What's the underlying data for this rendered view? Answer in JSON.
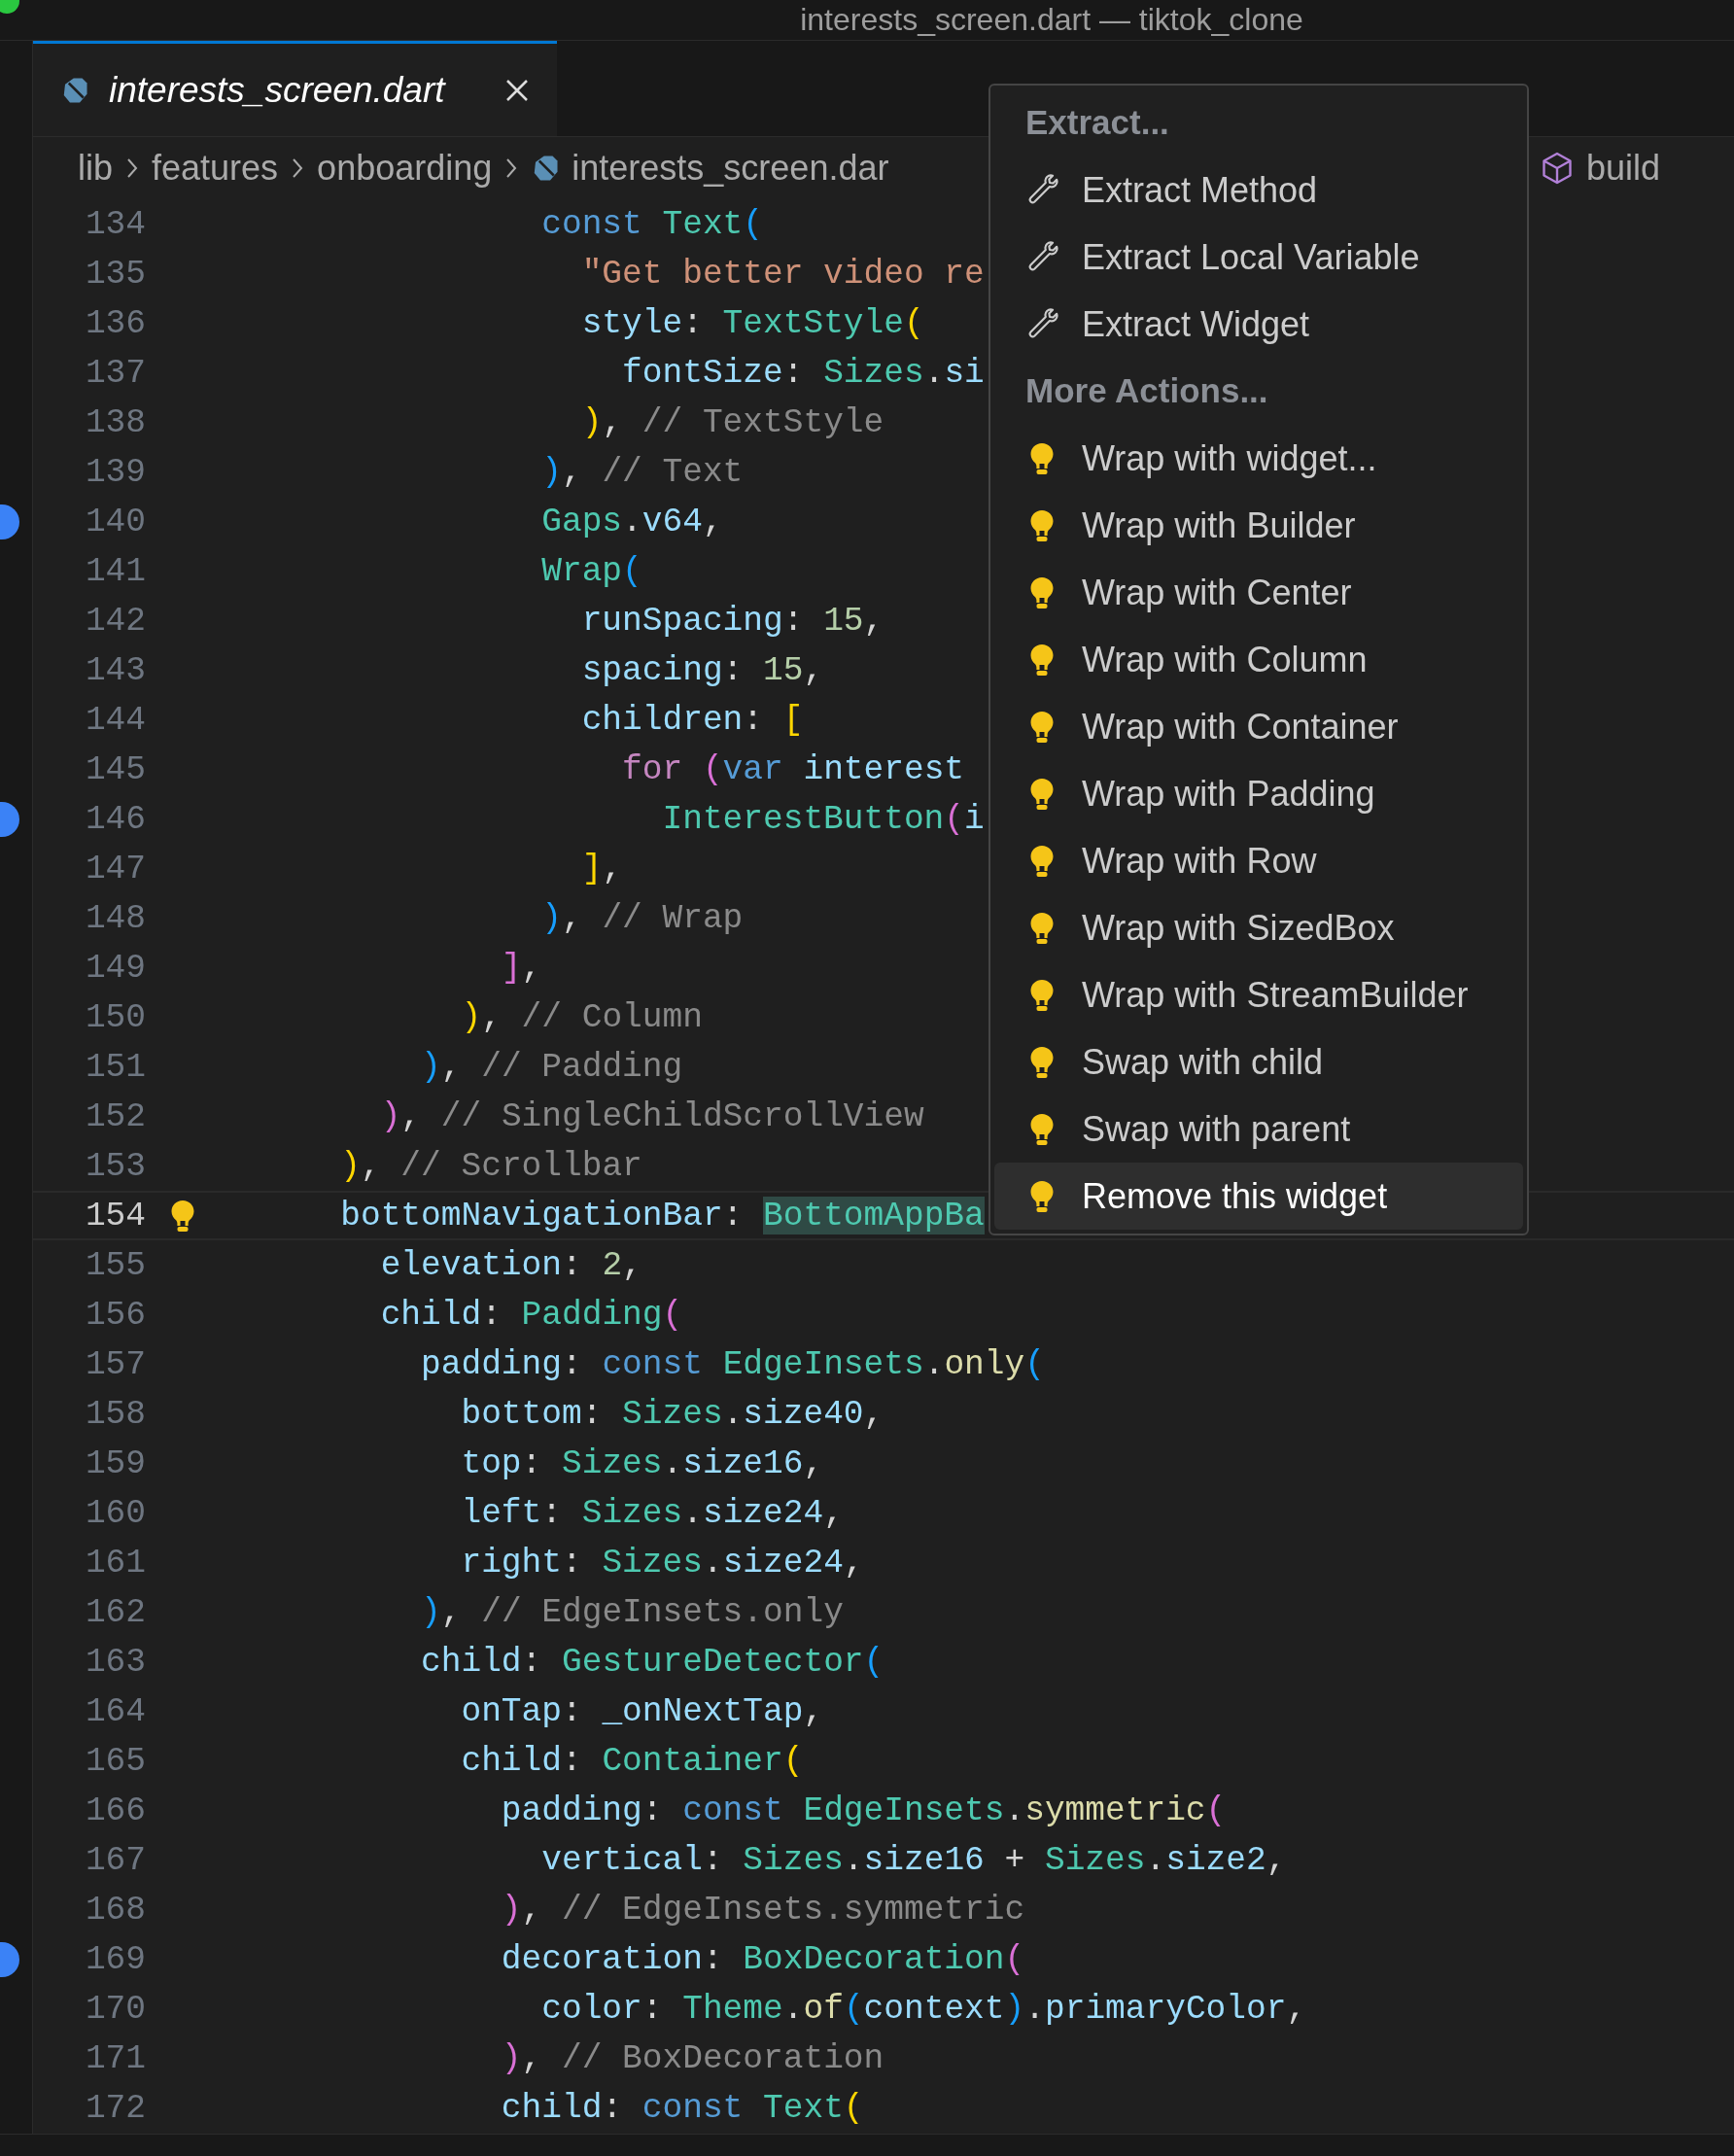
{
  "window": {
    "title": "interests_screen.dart — tiktok_clone"
  },
  "tabs": [
    {
      "label": "interests_screen.dart",
      "selected": true
    }
  ],
  "breadcrumb": [
    {
      "label": "lib",
      "kind": "folder"
    },
    {
      "label": "features",
      "kind": "folder"
    },
    {
      "label": "onboarding",
      "kind": "folder"
    },
    {
      "label": "interests_screen.dar",
      "kind": "file"
    },
    {
      "label": "build",
      "kind": "symbol"
    }
  ],
  "editor": {
    "lines": [
      {
        "number": "134",
        "active": false,
        "marked": false,
        "tokens": [
          {
            "kind": "keyword",
            "text": "                const "
          },
          {
            "kind": "type",
            "text": "Text"
          },
          {
            "kind": "bracket-blue",
            "text": "("
          }
        ]
      },
      {
        "number": "135",
        "active": false,
        "marked": false,
        "tokens": [
          {
            "kind": "string",
            "text": "                  \"Get better video re"
          }
        ]
      },
      {
        "number": "136",
        "active": false,
        "marked": false,
        "tokens": [
          {
            "kind": "prop",
            "text": "                  style"
          },
          {
            "kind": "plain",
            "text": ": "
          },
          {
            "kind": "type",
            "text": "TextStyle"
          },
          {
            "kind": "bracket-yellow",
            "text": "("
          }
        ]
      },
      {
        "number": "137",
        "active": false,
        "marked": false,
        "tokens": [
          {
            "kind": "prop",
            "text": "                    fontSize"
          },
          {
            "kind": "plain",
            "text": ": "
          },
          {
            "kind": "type",
            "text": "Sizes"
          },
          {
            "kind": "plain",
            "text": "."
          },
          {
            "kind": "prop",
            "text": "si"
          }
        ]
      },
      {
        "number": "138",
        "active": false,
        "marked": false,
        "tokens": [
          {
            "kind": "bracket-yellow",
            "text": "                  )"
          },
          {
            "kind": "plain",
            "text": ", "
          },
          {
            "kind": "comment",
            "text": "// TextStyle"
          }
        ]
      },
      {
        "number": "139",
        "active": false,
        "marked": false,
        "tokens": [
          {
            "kind": "bracket-blue",
            "text": "                )"
          },
          {
            "kind": "plain",
            "text": ", "
          },
          {
            "kind": "comment",
            "text": "// Text"
          }
        ]
      },
      {
        "number": "140",
        "active": false,
        "marked": true,
        "tokens": [
          {
            "kind": "type",
            "text": "                Gaps"
          },
          {
            "kind": "plain",
            "text": "."
          },
          {
            "kind": "prop",
            "text": "v64"
          },
          {
            "kind": "plain",
            "text": ","
          }
        ]
      },
      {
        "number": "141",
        "active": false,
        "marked": false,
        "tokens": [
          {
            "kind": "type",
            "text": "                Wrap"
          },
          {
            "kind": "bracket-blue",
            "text": "("
          }
        ]
      },
      {
        "number": "142",
        "active": false,
        "marked": false,
        "tokens": [
          {
            "kind": "prop",
            "text": "                  runSpacing"
          },
          {
            "kind": "plain",
            "text": ": "
          },
          {
            "kind": "number",
            "text": "15"
          },
          {
            "kind": "plain",
            "text": ","
          }
        ]
      },
      {
        "number": "143",
        "active": false,
        "marked": false,
        "tokens": [
          {
            "kind": "prop",
            "text": "                  spacing"
          },
          {
            "kind": "plain",
            "text": ": "
          },
          {
            "kind": "number",
            "text": "15"
          },
          {
            "kind": "plain",
            "text": ","
          }
        ]
      },
      {
        "number": "144",
        "active": false,
        "marked": false,
        "tokens": [
          {
            "kind": "prop",
            "text": "                  children"
          },
          {
            "kind": "plain",
            "text": ": "
          },
          {
            "kind": "bracket-yellow",
            "text": "["
          }
        ]
      },
      {
        "number": "145",
        "active": false,
        "marked": false,
        "tokens": [
          {
            "kind": "control",
            "text": "                    for "
          },
          {
            "kind": "bracket-purple",
            "text": "("
          },
          {
            "kind": "keyword",
            "text": "var "
          },
          {
            "kind": "prop",
            "text": "interest"
          }
        ]
      },
      {
        "number": "146",
        "active": false,
        "marked": true,
        "tokens": [
          {
            "kind": "type",
            "text": "                      InterestButton"
          },
          {
            "kind": "bracket-purple",
            "text": "("
          },
          {
            "kind": "prop",
            "text": "i"
          }
        ]
      },
      {
        "number": "147",
        "active": false,
        "marked": false,
        "tokens": [
          {
            "kind": "bracket-yellow",
            "text": "                  ]"
          },
          {
            "kind": "plain",
            "text": ","
          }
        ]
      },
      {
        "number": "148",
        "active": false,
        "marked": false,
        "tokens": [
          {
            "kind": "bracket-blue",
            "text": "                )"
          },
          {
            "kind": "plain",
            "text": ", "
          },
          {
            "kind": "comment",
            "text": "// Wrap"
          }
        ]
      },
      {
        "number": "149",
        "active": false,
        "marked": false,
        "tokens": [
          {
            "kind": "bracket-purple",
            "text": "              ]"
          },
          {
            "kind": "plain",
            "text": ","
          }
        ]
      },
      {
        "number": "150",
        "active": false,
        "marked": false,
        "tokens": [
          {
            "kind": "bracket-yellow",
            "text": "            )"
          },
          {
            "kind": "plain",
            "text": ", "
          },
          {
            "kind": "comment",
            "text": "// Column"
          }
        ]
      },
      {
        "number": "151",
        "active": false,
        "marked": false,
        "tokens": [
          {
            "kind": "bracket-blue",
            "text": "          )"
          },
          {
            "kind": "plain",
            "text": ", "
          },
          {
            "kind": "comment",
            "text": "// Padding"
          }
        ]
      },
      {
        "number": "152",
        "active": false,
        "marked": false,
        "tokens": [
          {
            "kind": "bracket-purple",
            "text": "        )"
          },
          {
            "kind": "plain",
            "text": ", "
          },
          {
            "kind": "comment",
            "text": "// SingleChildScrollView"
          }
        ]
      },
      {
        "number": "153",
        "active": false,
        "marked": false,
        "tokens": [
          {
            "kind": "bracket-yellow",
            "text": "      )"
          },
          {
            "kind": "plain",
            "text": ", "
          },
          {
            "kind": "comment",
            "text": "// Scrollbar"
          }
        ]
      },
      {
        "number": "154",
        "active": true,
        "marked": false,
        "tokens": [
          {
            "kind": "prop",
            "text": "      bottomNavigationBar"
          },
          {
            "kind": "plain",
            "text": ": "
          },
          {
            "kind": "selection",
            "text": "BottomAppBa"
          }
        ]
      },
      {
        "number": "155",
        "active": false,
        "marked": false,
        "tokens": [
          {
            "kind": "prop",
            "text": "        elevation"
          },
          {
            "kind": "plain",
            "text": ": "
          },
          {
            "kind": "number",
            "text": "2"
          },
          {
            "kind": "plain",
            "text": ","
          }
        ]
      },
      {
        "number": "156",
        "active": false,
        "marked": false,
        "tokens": [
          {
            "kind": "prop",
            "text": "        child"
          },
          {
            "kind": "plain",
            "text": ": "
          },
          {
            "kind": "type",
            "text": "Padding"
          },
          {
            "kind": "bracket-purple",
            "text": "("
          }
        ]
      },
      {
        "number": "157",
        "active": false,
        "marked": false,
        "tokens": [
          {
            "kind": "prop",
            "text": "          padding"
          },
          {
            "kind": "plain",
            "text": ": "
          },
          {
            "kind": "keyword",
            "text": "const "
          },
          {
            "kind": "type",
            "text": "EdgeInsets"
          },
          {
            "kind": "plain",
            "text": "."
          },
          {
            "kind": "method",
            "text": "only"
          },
          {
            "kind": "bracket-blue",
            "text": "("
          }
        ]
      },
      {
        "number": "158",
        "active": false,
        "marked": false,
        "tokens": [
          {
            "kind": "prop",
            "text": "            bottom"
          },
          {
            "kind": "plain",
            "text": ": "
          },
          {
            "kind": "type",
            "text": "Sizes"
          },
          {
            "kind": "plain",
            "text": "."
          },
          {
            "kind": "prop",
            "text": "size40"
          },
          {
            "kind": "plain",
            "text": ","
          }
        ]
      },
      {
        "number": "159",
        "active": false,
        "marked": false,
        "tokens": [
          {
            "kind": "prop",
            "text": "            top"
          },
          {
            "kind": "plain",
            "text": ": "
          },
          {
            "kind": "type",
            "text": "Sizes"
          },
          {
            "kind": "plain",
            "text": "."
          },
          {
            "kind": "prop",
            "text": "size16"
          },
          {
            "kind": "plain",
            "text": ","
          }
        ]
      },
      {
        "number": "160",
        "active": false,
        "marked": false,
        "tokens": [
          {
            "kind": "prop",
            "text": "            left"
          },
          {
            "kind": "plain",
            "text": ": "
          },
          {
            "kind": "type",
            "text": "Sizes"
          },
          {
            "kind": "plain",
            "text": "."
          },
          {
            "kind": "prop",
            "text": "size24"
          },
          {
            "kind": "plain",
            "text": ","
          }
        ]
      },
      {
        "number": "161",
        "active": false,
        "marked": false,
        "tokens": [
          {
            "kind": "prop",
            "text": "            right"
          },
          {
            "kind": "plain",
            "text": ": "
          },
          {
            "kind": "type",
            "text": "Sizes"
          },
          {
            "kind": "plain",
            "text": "."
          },
          {
            "kind": "prop",
            "text": "size24"
          },
          {
            "kind": "plain",
            "text": ","
          }
        ]
      },
      {
        "number": "162",
        "active": false,
        "marked": false,
        "tokens": [
          {
            "kind": "bracket-blue",
            "text": "          )"
          },
          {
            "kind": "plain",
            "text": ", "
          },
          {
            "kind": "comment",
            "text": "// EdgeInsets.only"
          }
        ]
      },
      {
        "number": "163",
        "active": false,
        "marked": false,
        "tokens": [
          {
            "kind": "prop",
            "text": "          child"
          },
          {
            "kind": "plain",
            "text": ": "
          },
          {
            "kind": "type",
            "text": "GestureDetector"
          },
          {
            "kind": "bracket-blue",
            "text": "("
          }
        ]
      },
      {
        "number": "164",
        "active": false,
        "marked": false,
        "tokens": [
          {
            "kind": "prop",
            "text": "            onTap"
          },
          {
            "kind": "plain",
            "text": ": "
          },
          {
            "kind": "prop",
            "text": "_onNextTap"
          },
          {
            "kind": "plain",
            "text": ","
          }
        ]
      },
      {
        "number": "165",
        "active": false,
        "marked": false,
        "tokens": [
          {
            "kind": "prop",
            "text": "            child"
          },
          {
            "kind": "plain",
            "text": ": "
          },
          {
            "kind": "type",
            "text": "Container"
          },
          {
            "kind": "bracket-yellow",
            "text": "("
          }
        ]
      },
      {
        "number": "166",
        "active": false,
        "marked": false,
        "tokens": [
          {
            "kind": "prop",
            "text": "              padding"
          },
          {
            "kind": "plain",
            "text": ": "
          },
          {
            "kind": "keyword",
            "text": "const "
          },
          {
            "kind": "type",
            "text": "EdgeInsets"
          },
          {
            "kind": "plain",
            "text": "."
          },
          {
            "kind": "method",
            "text": "symmetric"
          },
          {
            "kind": "bracket-purple",
            "text": "("
          }
        ]
      },
      {
        "number": "167",
        "active": false,
        "marked": false,
        "tokens": [
          {
            "kind": "prop",
            "text": "                vertical"
          },
          {
            "kind": "plain",
            "text": ": "
          },
          {
            "kind": "type",
            "text": "Sizes"
          },
          {
            "kind": "plain",
            "text": "."
          },
          {
            "kind": "prop",
            "text": "size16"
          },
          {
            "kind": "plain",
            "text": " + "
          },
          {
            "kind": "type",
            "text": "Sizes"
          },
          {
            "kind": "plain",
            "text": "."
          },
          {
            "kind": "prop",
            "text": "size2"
          },
          {
            "kind": "plain",
            "text": ","
          }
        ]
      },
      {
        "number": "168",
        "active": false,
        "marked": false,
        "tokens": [
          {
            "kind": "bracket-purple",
            "text": "              )"
          },
          {
            "kind": "plain",
            "text": ", "
          },
          {
            "kind": "comment",
            "text": "// EdgeInsets.symmetric"
          }
        ]
      },
      {
        "number": "169",
        "active": false,
        "marked": true,
        "tokens": [
          {
            "kind": "prop",
            "text": "              decoration"
          },
          {
            "kind": "plain",
            "text": ": "
          },
          {
            "kind": "type",
            "text": "BoxDecoration"
          },
          {
            "kind": "bracket-purple",
            "text": "("
          }
        ]
      },
      {
        "number": "170",
        "active": false,
        "marked": false,
        "tokens": [
          {
            "kind": "prop",
            "text": "                color"
          },
          {
            "kind": "plain",
            "text": ": "
          },
          {
            "kind": "type",
            "text": "Theme"
          },
          {
            "kind": "plain",
            "text": "."
          },
          {
            "kind": "method",
            "text": "of"
          },
          {
            "kind": "bracket-blue",
            "text": "("
          },
          {
            "kind": "prop",
            "text": "context"
          },
          {
            "kind": "bracket-blue",
            "text": ")"
          },
          {
            "kind": "plain",
            "text": "."
          },
          {
            "kind": "prop",
            "text": "primaryColor"
          },
          {
            "kind": "plain",
            "text": ","
          }
        ]
      },
      {
        "number": "171",
        "active": false,
        "marked": false,
        "tokens": [
          {
            "kind": "bracket-purple",
            "text": "              )"
          },
          {
            "kind": "plain",
            "text": ", "
          },
          {
            "kind": "comment",
            "text": "// BoxDecoration"
          }
        ]
      },
      {
        "number": "172",
        "active": false,
        "marked": false,
        "tokens": [
          {
            "kind": "prop",
            "text": "              child"
          },
          {
            "kind": "plain",
            "text": ": "
          },
          {
            "kind": "keyword",
            "text": "const "
          },
          {
            "kind": "type",
            "text": "Text"
          },
          {
            "kind": "bracket-yellow",
            "text": "("
          }
        ]
      }
    ]
  },
  "code_actions_menu": {
    "sections": [
      {
        "heading": "Extract...",
        "items": [
          {
            "label": "Extract Method",
            "kind": "refactor",
            "selected": false
          },
          {
            "label": "Extract Local Variable",
            "kind": "refactor",
            "selected": false
          },
          {
            "label": "Extract Widget",
            "kind": "refactor",
            "selected": false
          }
        ]
      },
      {
        "heading": "More Actions...",
        "items": [
          {
            "label": "Wrap with widget...",
            "kind": "quickfix",
            "selected": false
          },
          {
            "label": "Wrap with Builder",
            "kind": "quickfix",
            "selected": false
          },
          {
            "label": "Wrap with Center",
            "kind": "quickfix",
            "selected": false
          },
          {
            "label": "Wrap with Column",
            "kind": "quickfix",
            "selected": false
          },
          {
            "label": "Wrap with Container",
            "kind": "quickfix",
            "selected": false
          },
          {
            "label": "Wrap with Padding",
            "kind": "quickfix",
            "selected": false
          },
          {
            "label": "Wrap with Row",
            "kind": "quickfix",
            "selected": false
          },
          {
            "label": "Wrap with SizedBox",
            "kind": "quickfix",
            "selected": false
          },
          {
            "label": "Wrap with StreamBuilder",
            "kind": "quickfix",
            "selected": false
          },
          {
            "label": "Swap with child",
            "kind": "quickfix",
            "selected": false
          },
          {
            "label": "Swap with parent",
            "kind": "quickfix",
            "selected": false
          },
          {
            "label": "Remove this widget",
            "kind": "quickfix",
            "selected": true
          }
        ]
      }
    ]
  }
}
